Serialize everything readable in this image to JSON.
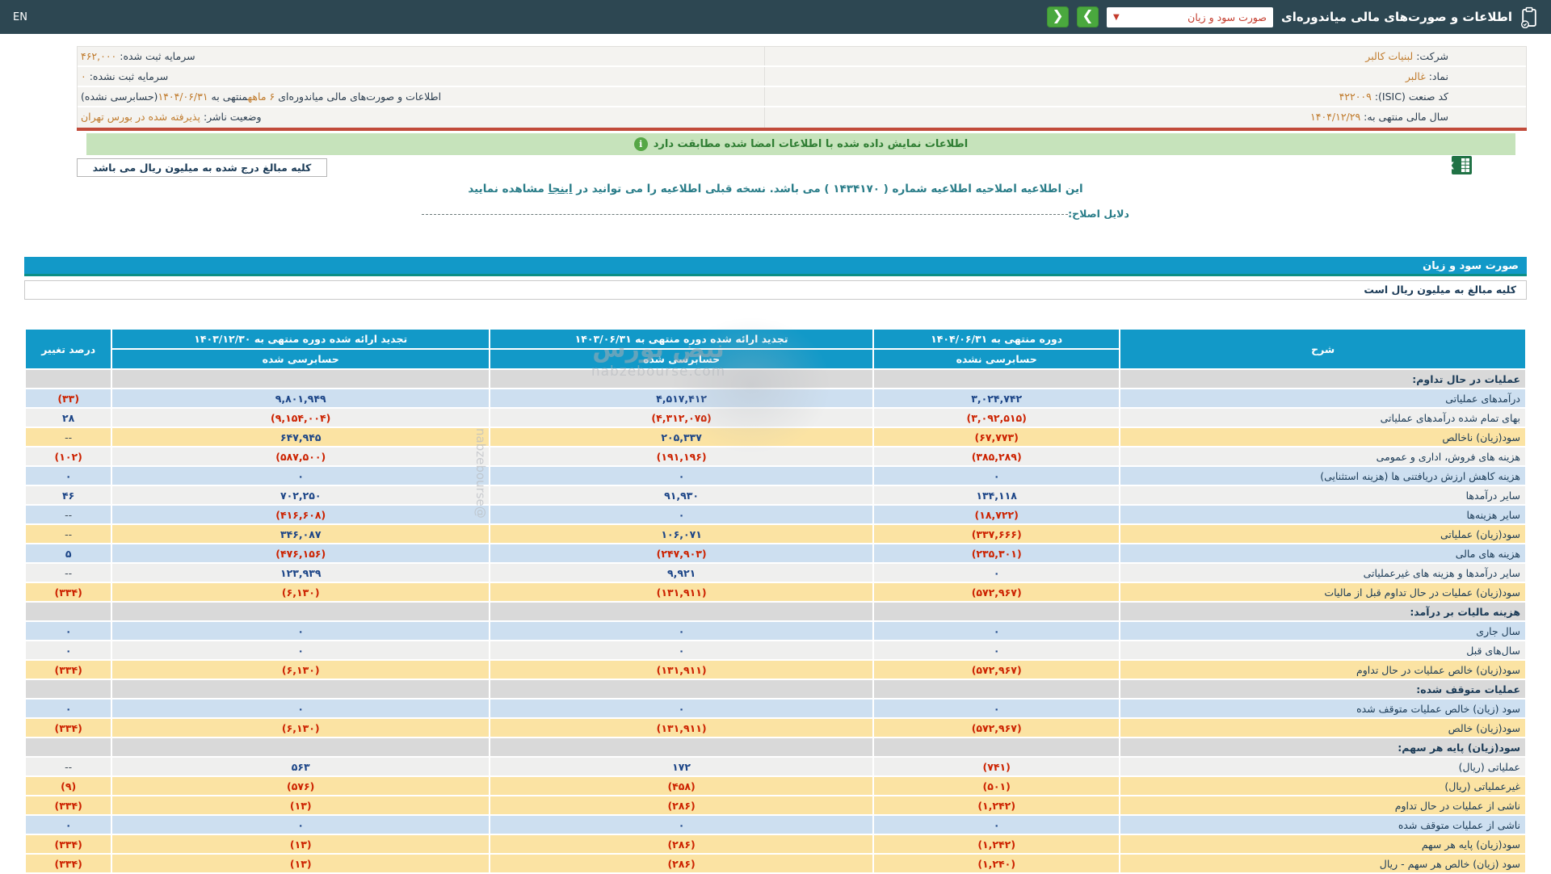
{
  "colors": {
    "topbar_bg": "#2d4752",
    "accent_cyan": "#1299c8",
    "teal_underline": "#0c8f86",
    "green_button": "#4aa83e",
    "banner_green_bg": "#c6e3bb",
    "banner_green_text": "#2e7d32",
    "red_divider": "#c14a3a",
    "dropdown_red": "#c43b2c",
    "row_blue": "#cddff0",
    "row_white": "#efefee",
    "row_yellow": "#fbe3a3",
    "row_section": "#d9d9d9",
    "value_positive": "#1c4587",
    "value_negative": "#cc2200",
    "info_value_orange": "#c07b2d",
    "notice_teal": "#2a7d89"
  },
  "topbar": {
    "en_label": "EN",
    "title": "اطلاعات و صورت‌های مالی میاندوره‌ای",
    "dropdown_value": "صورت سود و زیان",
    "dropdown_chevron": "▼",
    "nav_right": "❯",
    "nav_left": "❮"
  },
  "info": {
    "right_rows": [
      [
        {
          "t": "شرکت: ",
          "o": false
        },
        {
          "t": "لبنیات کالبر",
          "o": true
        }
      ],
      [
        {
          "t": "نماد: ",
          "o": false
        },
        {
          "t": "غالبر",
          "o": true
        }
      ],
      [
        {
          "t": "کد صنعت (ISIC): ",
          "o": false
        },
        {
          "t": "۴۲۲۰۰۹",
          "o": true
        }
      ],
      [
        {
          "t": "سال مالی منتهی به: ",
          "o": false
        },
        {
          "t": "۱۴۰۴/۱۲/۲۹",
          "o": true
        }
      ]
    ],
    "left_rows": [
      [
        {
          "t": "سرمایه ثبت شده: ",
          "o": false
        },
        {
          "t": "۴۶۲,۰۰۰",
          "o": true
        }
      ],
      [
        {
          "t": "سرمایه ثبت نشده: ",
          "o": false
        },
        {
          "t": "۰",
          "o": true
        }
      ],
      [
        {
          "t": "اطلاعات و صورت‌های مالی میاندوره‌ای ",
          "o": false
        },
        {
          "t": "۶ ماهه",
          "o": true
        },
        {
          "t": "منتهی به ",
          "o": false
        },
        {
          "t": "۱۴۰۴/۰۶/۳۱",
          "o": true
        },
        {
          "t": "(حسابرسی نشده)",
          "o": false
        }
      ]
    ],
    "left_row4": [
      [
        {
          "t": "وضعیت ناشر: ",
          "o": false
        },
        {
          "t": "پذیرفته شده در بورس تهران",
          "o": true
        }
      ]
    ]
  },
  "banner": {
    "icon": "i",
    "text": "اطلاعات نمایش داده شده با اطلاعات امضا شده مطابقت دارد"
  },
  "amounts_note": "کلیه مبالغ درج شده به میلیون ریال می باشد",
  "notice": {
    "before": "این اطلاعیه اصلاحیه اطلاعیه شماره ( ۱۴۳۴۱۷۰ ) می باشد. نسخه قبلی اطلاعیه را می توانید در ",
    "link": "اینجا",
    "after": " مشاهده نمایید"
  },
  "reasons_label": "دلایل اصلاح:",
  "section_bar_title": "صورت سود و زیان",
  "units_note": "کلیه مبالغ به میلیون ریال است",
  "watermark": {
    "fa": "نبض بورس",
    "domain": "nabzebourse.com",
    "handle": "@nabzebourse"
  },
  "table": {
    "headers": {
      "desc": "شرح",
      "period1": "دوره منتهی به ۱۴۰۴/۰۶/۳۱",
      "period1_sub": "حسابرسی نشده",
      "period2": "تجدید ارائه شده دوره منتهی به ۱۴۰۳/۰۶/۳۱",
      "period2_sub": "حسابرسی شده",
      "period3": "تجدید ارائه شده دوره منتهی به ۱۴۰۳/۱۲/۳۰",
      "period3_sub": "حسابرسی شده",
      "pct": "درصد تغییر"
    },
    "rows": [
      {
        "label": "عملیات در حال تداوم:",
        "style": "section"
      },
      {
        "label": "درآمدهای عملیاتی",
        "v1": "۳,۰۲۴,۷۴۲",
        "v2": "۴,۵۱۷,۴۱۲",
        "v3": "۹,۸۰۱,۹۴۹",
        "pct": "(۳۳)",
        "style": "blue"
      },
      {
        "label": "بهای تمام شده درآمدهای عملیاتی",
        "v1": "(۳,۰۹۲,۵۱۵)",
        "v2": "(۴,۳۱۲,۰۷۵)",
        "v3": "(۹,۱۵۴,۰۰۴)",
        "pct": "۲۸",
        "style": "white"
      },
      {
        "label": "سود(زیان) ناخالص",
        "v1": "(۶۷,۷۷۳)",
        "v2": "۲۰۵,۳۳۷",
        "v3": "۶۴۷,۹۴۵",
        "pct": "--",
        "style": "yellow"
      },
      {
        "label": "هزینه های فروش، اداری و عمومی",
        "v1": "(۳۸۵,۲۸۹)",
        "v2": "(۱۹۱,۱۹۶)",
        "v3": "(۵۸۷,۵۰۰)",
        "pct": "(۱۰۲)",
        "style": "white"
      },
      {
        "label": "هزینه کاهش ارزش دریافتنی ها (هزینه استثنایی)",
        "v1": "۰",
        "v2": "۰",
        "v3": "۰",
        "pct": "۰",
        "style": "blue"
      },
      {
        "label": "سایر درآمدها",
        "v1": "۱۳۴,۱۱۸",
        "v2": "۹۱,۹۳۰",
        "v3": "۷۰۲,۲۵۰",
        "pct": "۴۶",
        "style": "white"
      },
      {
        "label": "سایر هزینه‌ها",
        "v1": "(۱۸,۷۲۲)",
        "v2": "۰",
        "v3": "(۴۱۶,۶۰۸)",
        "pct": "--",
        "style": "blue"
      },
      {
        "label": "سود(زیان) عملیاتی",
        "v1": "(۳۳۷,۶۶۶)",
        "v2": "۱۰۶,۰۷۱",
        "v3": "۳۴۶,۰۸۷",
        "pct": "--",
        "style": "yellow"
      },
      {
        "label": "هزینه های مالی",
        "v1": "(۲۳۵,۳۰۱)",
        "v2": "(۲۴۷,۹۰۳)",
        "v3": "(۴۷۶,۱۵۶)",
        "pct": "۵",
        "style": "blue"
      },
      {
        "label": "سایر درآمدها و هزینه های غیرعملیاتی",
        "v1": "۰",
        "v2": "۹,۹۲۱",
        "v3": "۱۲۳,۹۳۹",
        "pct": "--",
        "style": "white"
      },
      {
        "label": "سود(زیان) عملیات در حال تداوم قبل از مالیات",
        "v1": "(۵۷۲,۹۶۷)",
        "v2": "(۱۳۱,۹۱۱)",
        "v3": "(۶,۱۳۰)",
        "pct": "(۳۳۴)",
        "style": "yellow"
      },
      {
        "label": "هزینه مالیات بر درآمد:",
        "style": "section"
      },
      {
        "label": "سال جاری",
        "v1": "۰",
        "v2": "۰",
        "v3": "۰",
        "pct": "۰",
        "style": "blue"
      },
      {
        "label": "سال‌های قبل",
        "v1": "۰",
        "v2": "۰",
        "v3": "۰",
        "pct": "۰",
        "style": "white"
      },
      {
        "label": "سود(زیان) خالص عملیات در حال تداوم",
        "v1": "(۵۷۲,۹۶۷)",
        "v2": "(۱۳۱,۹۱۱)",
        "v3": "(۶,۱۳۰)",
        "pct": "(۳۳۴)",
        "style": "yellow"
      },
      {
        "label": "عملیات متوقف شده:",
        "style": "section"
      },
      {
        "label": "سود (زیان) خالص عملیات متوقف شده",
        "v1": "۰",
        "v2": "۰",
        "v3": "۰",
        "pct": "۰",
        "style": "blue"
      },
      {
        "label": "سود(زیان) خالص",
        "v1": "(۵۷۲,۹۶۷)",
        "v2": "(۱۳۱,۹۱۱)",
        "v3": "(۶,۱۳۰)",
        "pct": "(۳۳۴)",
        "style": "yellow"
      },
      {
        "label": "سود(زیان) پایه هر سهم:",
        "style": "section"
      },
      {
        "label": "عملیاتی (ریال)",
        "v1": "(۷۴۱)",
        "v2": "۱۷۲",
        "v3": "۵۶۳",
        "pct": "--",
        "style": "white"
      },
      {
        "label": "غیرعملیاتی (ریال)",
        "v1": "(۵۰۱)",
        "v2": "(۴۵۸)",
        "v3": "(۵۷۶)",
        "pct": "(۹)",
        "style": "yellow"
      },
      {
        "label": "ناشی از عملیات در حال تداوم",
        "v1": "(۱,۲۴۲)",
        "v2": "(۲۸۶)",
        "v3": "(۱۳)",
        "pct": "(۳۳۴)",
        "style": "yellow"
      },
      {
        "label": "ناشی از عملیات متوقف شده",
        "v1": "۰",
        "v2": "۰",
        "v3": "۰",
        "pct": "۰",
        "style": "blue"
      },
      {
        "label": "سود(زیان) پایه هر سهم",
        "v1": "(۱,۲۴۲)",
        "v2": "(۲۸۶)",
        "v3": "(۱۳)",
        "pct": "(۳۳۴)",
        "style": "yellow"
      },
      {
        "label": "سود (زیان) خالص هر سهم - ریال",
        "v1": "(۱,۲۴۰)",
        "v2": "(۲۸۶)",
        "v3": "(۱۳)",
        "pct": "(۳۳۴)",
        "style": "yellow"
      }
    ]
  }
}
